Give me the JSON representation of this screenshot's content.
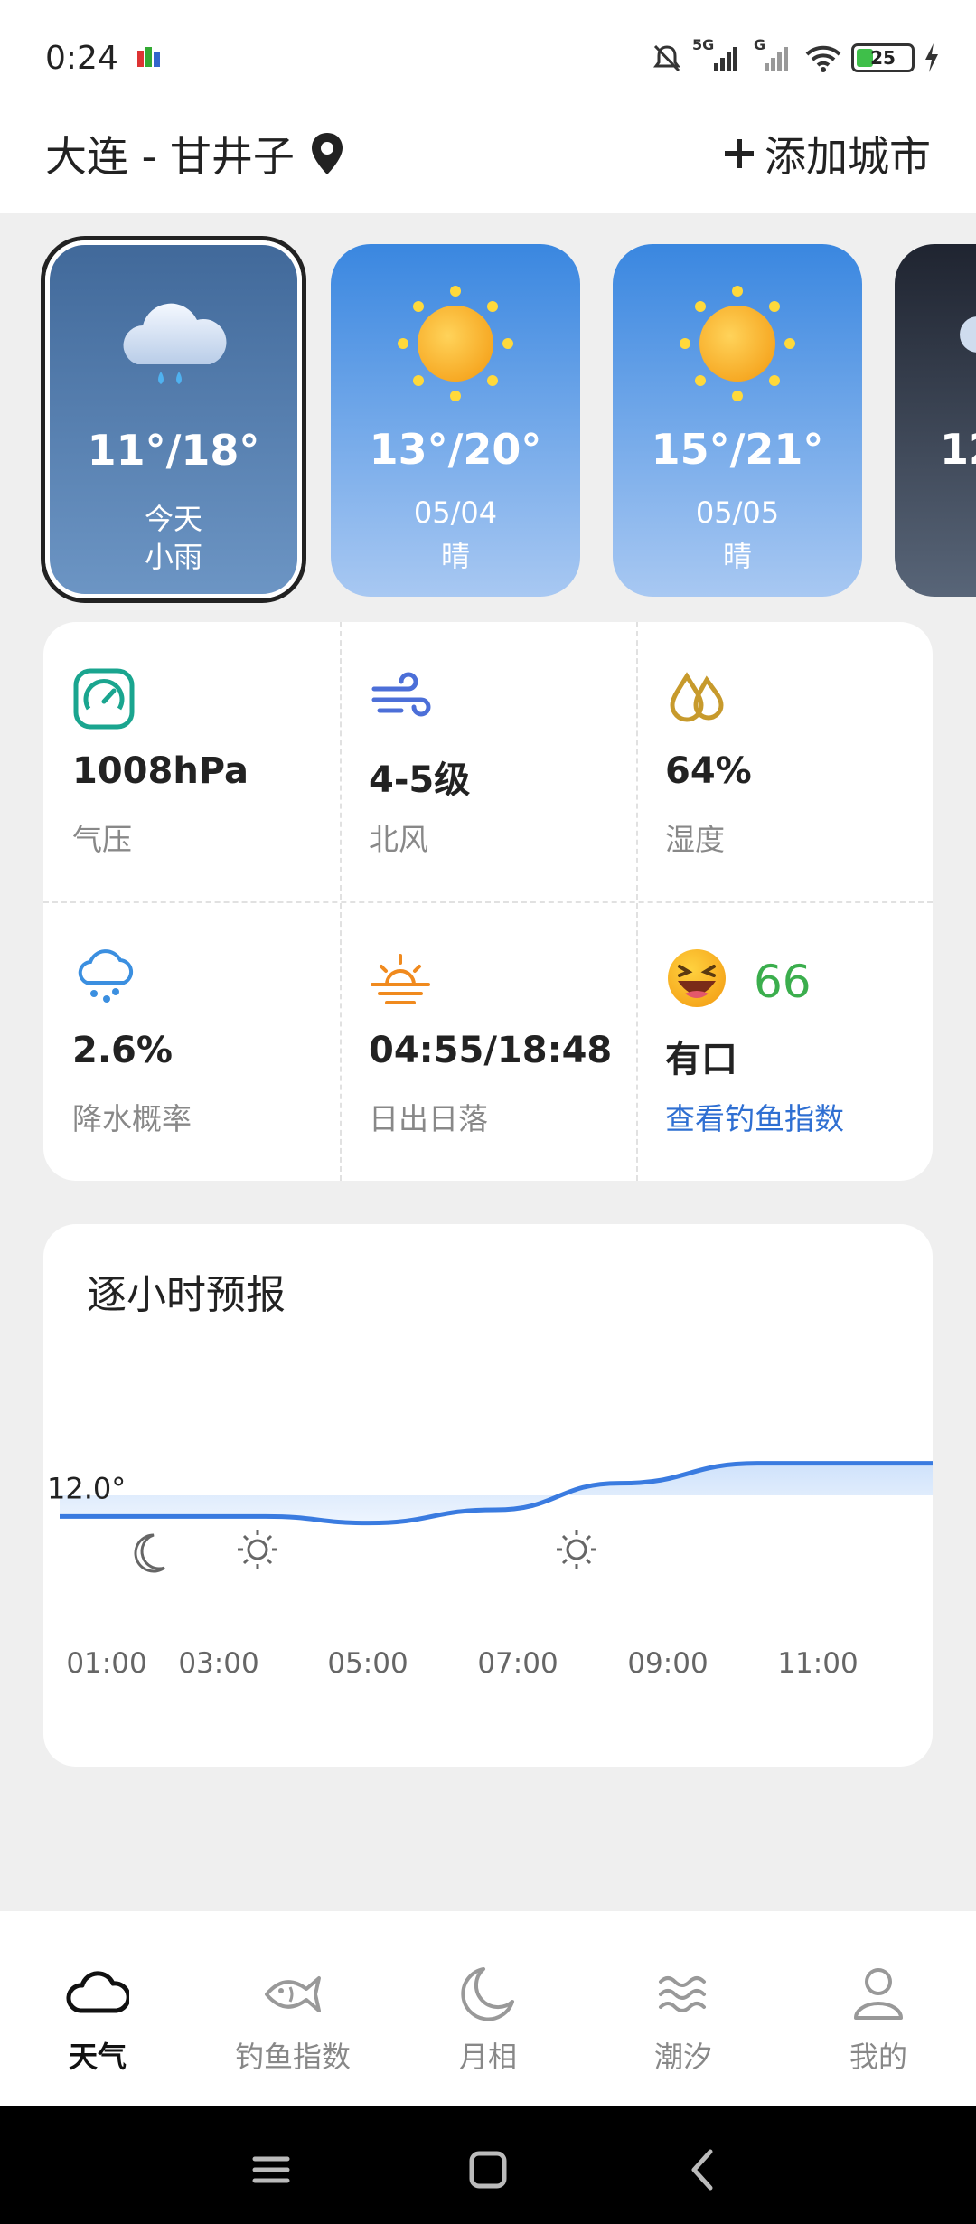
{
  "status_bar": {
    "time": "0:24",
    "signal_1": "5G",
    "signal_2": "G",
    "battery": "25"
  },
  "header": {
    "location": "大连 - 甘井子",
    "add_city": "添加城市"
  },
  "forecast": [
    {
      "temp": "11°/18°",
      "line1": "今天",
      "line2": "小雨",
      "icon": "rain-cloud-icon"
    },
    {
      "temp": "13°/20°",
      "line1": "05/04",
      "line2": "晴",
      "icon": "sun-icon"
    },
    {
      "temp": "15°/21°",
      "line1": "05/05",
      "line2": "晴",
      "icon": "sun-icon"
    },
    {
      "temp": "12",
      "line1": "",
      "line2": "",
      "icon": "partial-card"
    }
  ],
  "details": {
    "pressure": {
      "value": "1008hPa",
      "label": "气压"
    },
    "wind": {
      "value": "4-5级",
      "label": "北风"
    },
    "humidity": {
      "value": "64%",
      "label": "湿度"
    },
    "precipitation": {
      "value": "2.6%",
      "label": "降水概率"
    },
    "sun": {
      "value": "04:55/18:48",
      "label": "日出日落"
    },
    "fishing": {
      "score": "66",
      "value": "有口",
      "label": "查看钓鱼指数"
    }
  },
  "hourly": {
    "title": "逐小时预报",
    "current_temp_label": "12.0°",
    "times": [
      "01:00",
      "03:00",
      "05:00",
      "07:00",
      "09:00",
      "11:00"
    ]
  },
  "chart_data": {
    "type": "area",
    "title": "逐小时预报",
    "x": [
      "01:00",
      "03:00",
      "05:00",
      "07:00",
      "09:00",
      "11:00"
    ],
    "series": [
      {
        "values": [
          12.0,
          12.0,
          11.8,
          12.2,
          13.0,
          13.6
        ]
      }
    ]
  },
  "bottom_nav": [
    {
      "label": "天气",
      "icon": "cloud-icon",
      "active": true
    },
    {
      "label": "钓鱼指数",
      "icon": "fish-icon",
      "active": false
    },
    {
      "label": "月相",
      "icon": "moon-icon",
      "active": false
    },
    {
      "label": "潮汐",
      "icon": "waves-icon",
      "active": false
    },
    {
      "label": "我的",
      "icon": "user-icon",
      "active": false
    }
  ],
  "colors": {
    "accent": "#2f6fd2",
    "chart_line": "#3a7be0",
    "score_green": "#3bae4d"
  }
}
